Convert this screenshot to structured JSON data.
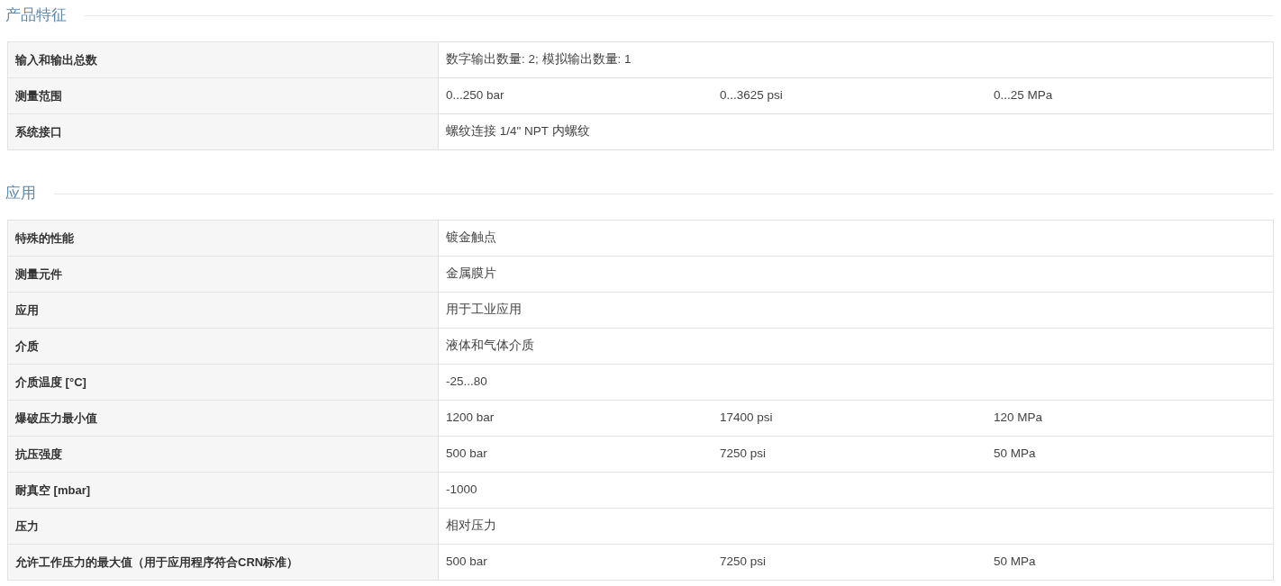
{
  "sections": [
    {
      "title": "产品特征",
      "rows": [
        {
          "label": "输入和输出总数",
          "values": [
            "数字输出数量: 2; 模拟输出数量: 1"
          ]
        },
        {
          "label": "测量范围",
          "values": [
            "0...250 bar",
            "0...3625 psi",
            "0...25 MPa"
          ]
        },
        {
          "label": "系统接口",
          "values": [
            "螺纹连接 1/4\" NPT 内螺纹"
          ]
        }
      ]
    },
    {
      "title": "应用",
      "rows": [
        {
          "label": "特殊的性能",
          "values": [
            "镀金触点"
          ]
        },
        {
          "label": "测量元件",
          "values": [
            "金属膜片"
          ]
        },
        {
          "label": "应用",
          "values": [
            "用于工业应用"
          ]
        },
        {
          "label": "介质",
          "values": [
            "液体和气体介质"
          ]
        },
        {
          "label": "介质温度 [°C]",
          "values": [
            "-25...80"
          ]
        },
        {
          "label": "爆破压力最小值",
          "values": [
            "1200 bar",
            "17400 psi",
            "120 MPa"
          ]
        },
        {
          "label": "抗压强度",
          "values": [
            "500 bar",
            "7250 psi",
            "50 MPa"
          ]
        },
        {
          "label": "耐真空 [mbar]",
          "values": [
            "-1000"
          ]
        },
        {
          "label": "压力",
          "values": [
            "相对压力"
          ]
        },
        {
          "label": "允许工作压力的最大值（用于应用程序符合CRN标准）",
          "values": [
            "500 bar",
            "7250 psi",
            "50 MPa"
          ]
        }
      ]
    }
  ]
}
